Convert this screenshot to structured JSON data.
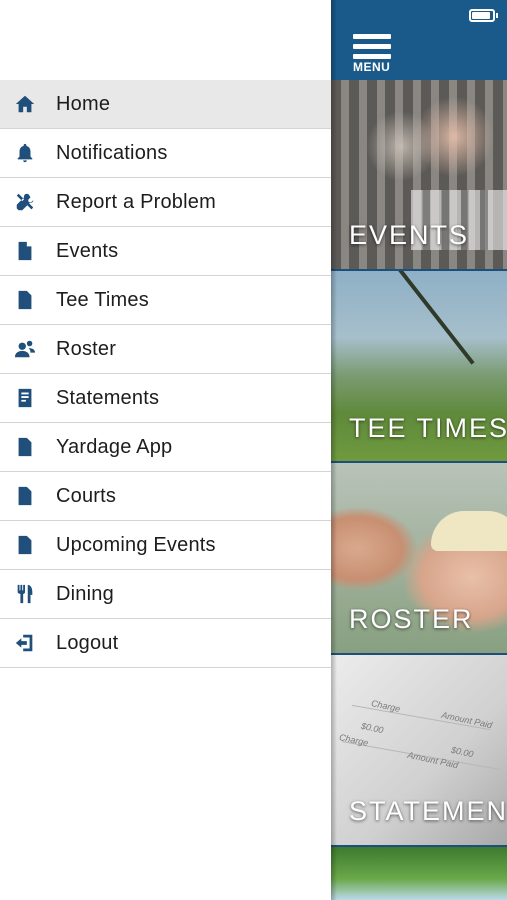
{
  "status_bar": {
    "battery": "battery-full"
  },
  "header": {
    "menu_label": "MENU"
  },
  "drawer": {
    "items": [
      {
        "label": "Home",
        "icon": "home-icon",
        "active": true
      },
      {
        "label": "Notifications",
        "icon": "bell-icon"
      },
      {
        "label": "Report a Problem",
        "icon": "tools-icon"
      },
      {
        "label": "Events",
        "icon": "document-icon"
      },
      {
        "label": "Tee Times",
        "icon": "document-icon"
      },
      {
        "label": "Roster",
        "icon": "people-icon"
      },
      {
        "label": "Statements",
        "icon": "statement-icon"
      },
      {
        "label": "Yardage App",
        "icon": "document-icon"
      },
      {
        "label": "Courts",
        "icon": "document-icon"
      },
      {
        "label": "Upcoming Events",
        "icon": "document-icon"
      },
      {
        "label": "Dining",
        "icon": "utensils-icon"
      },
      {
        "label": "Logout",
        "icon": "logout-icon"
      }
    ]
  },
  "tiles": {
    "events": "EVENTS",
    "tee_times": "TEE TIMES",
    "roster": "ROSTER",
    "statements": "STATEMENTS",
    "statement_doc": [
      "Charge",
      "Amount Paid",
      "$0.00",
      "Charge",
      "Amount Paid",
      "$0.00"
    ]
  },
  "colors": {
    "brand_blue": "#1a5a8a",
    "icon_blue": "#1f4f7a",
    "active_row": "#e8e8e8"
  }
}
